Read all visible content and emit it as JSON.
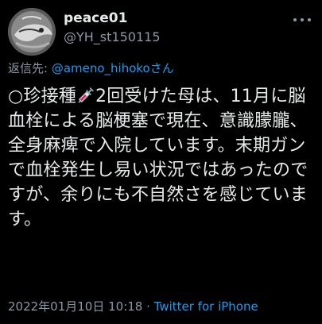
{
  "tweet": {
    "author": {
      "display_name": "peace01",
      "handle": "@YH_st150115",
      "avatar_icon": "avatar-photo"
    },
    "more_icon": "more-dots-icon",
    "reply_to": {
      "prefix": "返信先: ",
      "mention": "@ameno_hihoko",
      "suffix": "さん"
    },
    "text_before_icon": "○珍接種",
    "inline_icon": "syringe-icon",
    "text_after_icon": "2回受けた母は、11月に脳血栓による脳梗塞で現在、意識朦朧、全身麻痺で入院しています。末期ガンで血栓発生し易い状況ではあったのですが、余りにも不自然さを感じています。",
    "timestamp": "2022年01月10日 10:18",
    "separator": " · ",
    "source": "Twitter for iPhone"
  },
  "colors": {
    "background": "#000000",
    "text_primary": "#e7e9ea",
    "text_secondary": "#8b98a5",
    "link": "#1d9bf0"
  }
}
